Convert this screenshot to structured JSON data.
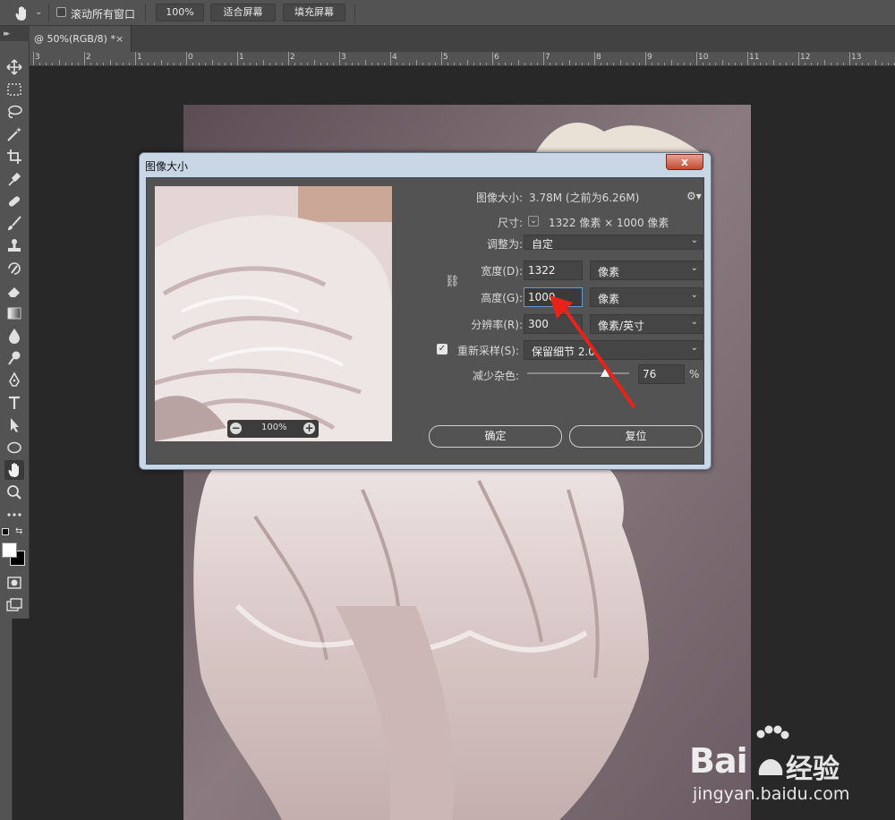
{
  "options_bar": {
    "tool_icon": "hand-icon",
    "scroll_all_windows_label": "滚动所有窗口",
    "scroll_all_windows_checked": false,
    "zoom_100_label": "100%",
    "fit_screen_label": "适合屏幕",
    "fill_screen_label": "填充屏幕"
  },
  "document_tab": {
    "label": "@ 50%(RGB/8) *",
    "close": "×"
  },
  "toolbar": {
    "tools": [
      "move-icon",
      "marquee-icon",
      "lasso-icon",
      "magic-wand-icon",
      "crop-icon",
      "eyedropper-icon",
      "healing-brush-icon",
      "brush-icon",
      "clone-stamp-icon",
      "history-brush-icon",
      "eraser-icon",
      "gradient-icon",
      "blur-icon",
      "dodge-icon",
      "pen-icon",
      "type-icon",
      "path-selection-icon",
      "ellipse-icon",
      "hand-icon",
      "zoom-icon",
      "more-icon"
    ],
    "active_tool": "hand-icon"
  },
  "ruler": {
    "labels": [
      "3",
      "2",
      "1",
      "0",
      "1",
      "2",
      "3",
      "4",
      "5",
      "6",
      "7",
      "8",
      "9",
      "10",
      "11",
      "12",
      "13"
    ]
  },
  "dialog": {
    "title": "图像大小",
    "close_label": "x",
    "image_size_label": "图像大小:",
    "image_size_value": "3.78M (之前为6.26M)",
    "dimensions_label": "尺寸:",
    "dimensions_value": "1322 像素  ×  1000 像素",
    "fit_to_label": "调整为:",
    "fit_to_value": "自定",
    "width_label": "宽度(D):",
    "width_value": "1322",
    "width_unit": "像素",
    "height_label": "高度(G):",
    "height_value": "1000",
    "height_unit": "像素",
    "resolution_label": "分辨率(R):",
    "resolution_value": "300",
    "resolution_unit": "像素/英寸",
    "resample_label": "重新采样(S):",
    "resample_checked": true,
    "resample_value": "保留细节 2.0",
    "reduce_noise_label": "减少杂色:",
    "reduce_noise_value": "76",
    "reduce_noise_unit": "%",
    "reduce_noise_level": 0.76,
    "preview_zoom": "100%",
    "ok_label": "确定",
    "reset_label": "复位"
  },
  "watermark": {
    "brand": "Bai",
    "brand_cn": "经验",
    "url": "jingyan.baidu.com"
  },
  "colors": {
    "annotation_arrow": "#e8231a",
    "focus_border": "#5c9bd6"
  }
}
